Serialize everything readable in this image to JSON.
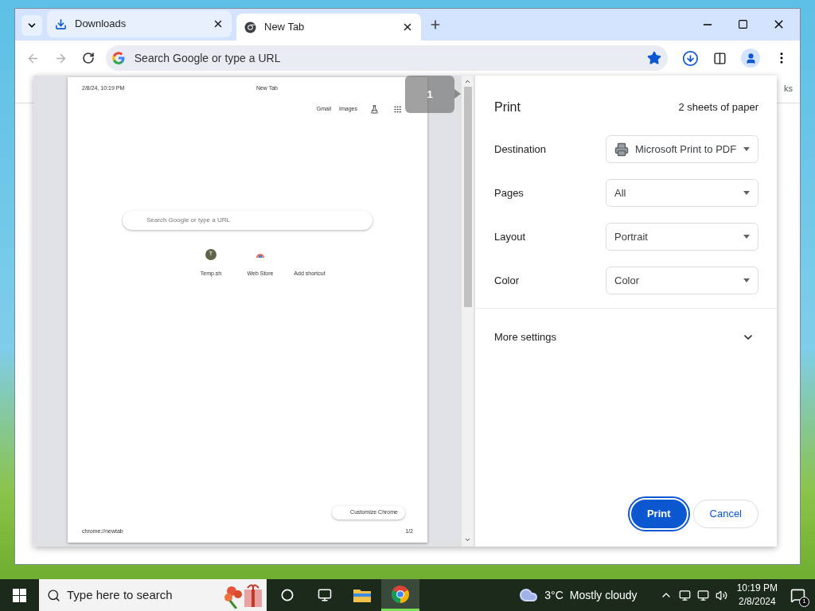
{
  "tabs": [
    {
      "title": "Downloads",
      "kind": "download",
      "selected": false
    },
    {
      "title": "New Tab",
      "kind": "chrome",
      "selected": true
    }
  ],
  "address_bar": {
    "placeholder": "Search Google or type a URL",
    "bookmarked": true
  },
  "background_fragment": "ks",
  "preview": {
    "header_left": "2/8/24, 10:19 PM",
    "header_center": "New Tab",
    "top_links": [
      "Gmail",
      "Images"
    ],
    "search_placeholder": "Search Google or type a URL",
    "shortcuts": [
      {
        "label": "Temp.sh",
        "kind": "letter",
        "letter": "T"
      },
      {
        "label": "Web Store",
        "kind": "store"
      },
      {
        "label": "Add shortcut",
        "kind": "add"
      }
    ],
    "customize": "Customize Chrome",
    "footer_left": "chrome://newtab",
    "footer_right": "1/2",
    "page_badge": "1"
  },
  "print": {
    "title": "Print",
    "sheets": "2 sheets of paper",
    "settings": [
      {
        "label": "Destination",
        "value": "Microsoft Print to PDF",
        "kind": "printer"
      },
      {
        "label": "Pages",
        "value": "All",
        "kind": "plain"
      },
      {
        "label": "Layout",
        "value": "Portrait",
        "kind": "plain"
      },
      {
        "label": "Color",
        "value": "Color",
        "kind": "plain"
      }
    ],
    "more_settings": "More settings",
    "more_expanded": false,
    "buttons": [
      {
        "label": "Print",
        "primary": true
      },
      {
        "label": "Cancel",
        "primary": false
      }
    ]
  },
  "taskbar": {
    "search_placeholder": "Type here to search",
    "apps": [
      {
        "kind": "files",
        "selected": false
      },
      {
        "kind": "chrome",
        "selected": true
      }
    ],
    "weather": {
      "temp": "3°C",
      "condition": "Mostly cloudy"
    },
    "clock": {
      "time": "10:19 PM",
      "date": "2/8/2024"
    },
    "notifications": "1"
  }
}
